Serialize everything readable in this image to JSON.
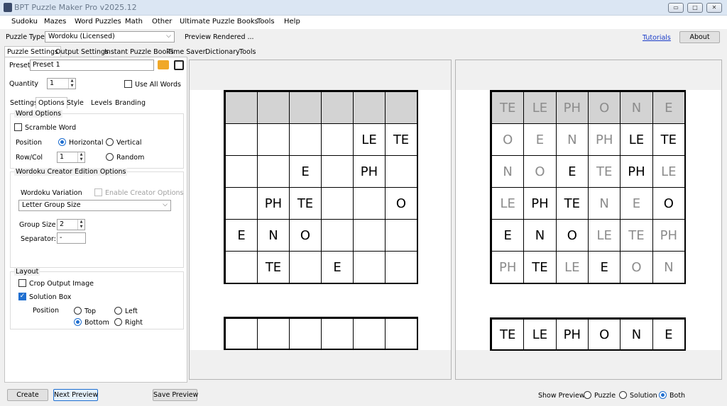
{
  "window": {
    "title": "BPT Puzzle Maker Pro v2025.12",
    "min_glyph": "▭",
    "max_glyph": "□",
    "close_glyph": "✕"
  },
  "menu": [
    "Sudoku",
    "Mazes",
    "Word Puzzles",
    "Math",
    "Other",
    "Ultimate Puzzle Books",
    "Tools",
    "Help"
  ],
  "toolbar": {
    "puzzle_type_label": "Puzzle Type",
    "puzzle_type_value": "Wordoku (Licensed)",
    "status": "Preview Rendered ...",
    "tutorials": "Tutorials",
    "about": "About"
  },
  "main_tabs": [
    "Puzzle Settings",
    "Output Settings",
    "Instant Puzzle Books",
    "Time Saver",
    "Dictionary",
    "Tools"
  ],
  "preset": {
    "label": "Preset",
    "value": "Preset 1"
  },
  "quantity": {
    "label": "Quantity",
    "value": "1",
    "use_all_words": "Use All Words"
  },
  "sub_tabs": [
    "Settings",
    "Options",
    "Style",
    "Levels",
    "Branding"
  ],
  "word_options": {
    "title": "Word Options",
    "scramble": "Scramble Word",
    "position_label": "Position",
    "horizontal": "Horizontal",
    "vertical": "Vertical",
    "rowcol_label": "Row/Col",
    "rowcol_value": "1",
    "random": "Random"
  },
  "creator": {
    "title": "Wordoku Creator Edition Options",
    "variation_label": "Wordoku Variation",
    "enable_creator": "Enable Creator Options",
    "variation_value": "Letter Group Size",
    "group_size_label": "Group Size",
    "group_size_value": "2",
    "separator_label": "Separator:",
    "separator_value": "-"
  },
  "layout": {
    "title": "Layout",
    "crop": "Crop Output Image",
    "solution_box": "Solution Box",
    "position_label": "Position",
    "top": "Top",
    "left": "Left",
    "bottom": "Bottom",
    "right": "Right"
  },
  "bottom": {
    "create": "Create",
    "next_preview": "Next Preview",
    "save_preview": "Save Preview",
    "show_preview": "Show Preview:",
    "opt_puzzle": "Puzzle",
    "opt_solution": "Solution",
    "opt_both": "Both"
  },
  "puzzle_grid": [
    [
      "",
      "",
      "",
      "",
      "",
      ""
    ],
    [
      "",
      "",
      "",
      "",
      "LE",
      "TE"
    ],
    [
      "",
      "",
      "E",
      "",
      "PH",
      ""
    ],
    [
      "",
      "PH",
      "TE",
      "",
      "",
      "O"
    ],
    [
      "E",
      "N",
      "O",
      "",
      "",
      ""
    ],
    [
      "",
      "TE",
      "",
      "E",
      "",
      ""
    ]
  ],
  "puzzle_answer": [
    "",
    "",
    "",
    "",
    "",
    ""
  ],
  "solution_grid": [
    [
      "TE",
      "LE",
      "PH",
      "O",
      "N",
      "E"
    ],
    [
      "O",
      "E",
      "N",
      "PH",
      "LE",
      "TE"
    ],
    [
      "N",
      "O",
      "E",
      "TE",
      "PH",
      "LE"
    ],
    [
      "LE",
      "PH",
      "TE",
      "N",
      "E",
      "O"
    ],
    [
      "E",
      "N",
      "O",
      "LE",
      "TE",
      "PH"
    ],
    [
      "PH",
      "TE",
      "LE",
      "E",
      "O",
      "N"
    ]
  ],
  "solution_given": [
    [
      0,
      0,
      0,
      0,
      0,
      0
    ],
    [
      0,
      0,
      0,
      0,
      1,
      1
    ],
    [
      0,
      0,
      1,
      0,
      1,
      0
    ],
    [
      0,
      1,
      1,
      0,
      0,
      1
    ],
    [
      1,
      1,
      1,
      0,
      0,
      0
    ],
    [
      0,
      1,
      0,
      1,
      0,
      0
    ]
  ],
  "solution_answer": [
    "TE",
    "LE",
    "PH",
    "O",
    "N",
    "E"
  ],
  "colors": {
    "accent": "#1f6fd0",
    "given": "#000000",
    "filled": "#8c8c8c",
    "header_row": "#d3d3d3"
  }
}
